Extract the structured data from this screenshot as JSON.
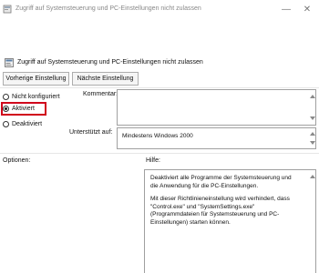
{
  "window": {
    "title": "Zugriff auf Systemsteuerung und PC-Einstellungen nicht zulassen",
    "minimize_glyph": "—",
    "close_glyph": "✕"
  },
  "header": {
    "policy_name": "Zugriff auf Systemsteuerung und PC-Einstellungen nicht zulassen",
    "prev_button": "Vorherige Einstellung",
    "next_button": "Nächste Einstellung"
  },
  "options": {
    "not_configured": "Nicht konfiguriert",
    "enabled": "Aktiviert",
    "disabled": "Deaktiviert",
    "selected": "enabled"
  },
  "fields": {
    "comment_label": "Kommentar:",
    "supported_label": "Unterstützt auf:",
    "supported_value": "Mindestens Windows 2000"
  },
  "sections": {
    "options_label": "Optionen:",
    "help_label": "Hilfe:"
  },
  "help": {
    "paragraph1": "Deaktiviert alle Programme der Systemsteuerung und die Anwendung für die PC-Einstellungen.",
    "paragraph2": "Mit dieser Richtlinieneinstellung wird verhindert, dass \"Control.exe\" und \"SystemSettings.exe\" (Programmdateien für Systemsteuerung und PC-Einstellungen) starten können."
  },
  "colors": {
    "highlight_border": "#d0021b",
    "background": "#ffffff"
  }
}
